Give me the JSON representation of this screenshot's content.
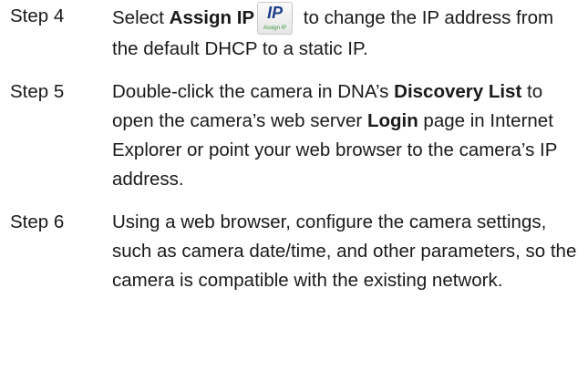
{
  "steps": [
    {
      "label": "Step 4",
      "pre": "Select ",
      "bold": "Assign IP",
      "post": " to change the IP address from the default DHCP to a static IP."
    },
    {
      "label": "Step 5",
      "pre": "Double-click the camera in DNA’s ",
      "bold": "Discovery List",
      "mid": " to open the camera’s web server ",
      "bold2": "Login",
      "post": " page in Internet Explorer or point your web browser to the camera’s IP address."
    },
    {
      "label": "Step 6",
      "text": "Using a web browser, configure the camera settings, such as camera date/time, and other parameters, so the camera is compatible with the existing network."
    }
  ],
  "assign_ip_button": {
    "glyph": "IP",
    "caption": "Assign IP",
    "icon": "assign-ip-icon"
  }
}
